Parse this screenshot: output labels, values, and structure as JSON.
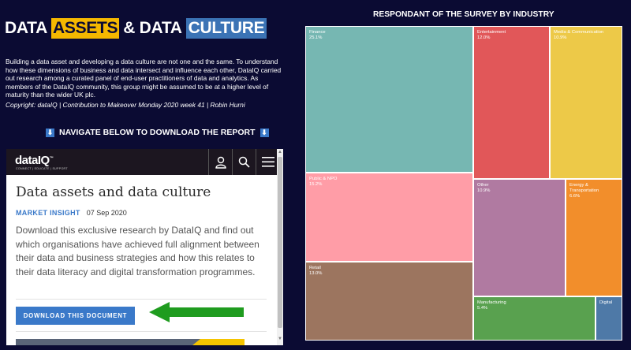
{
  "header": {
    "title_part1": "DATA",
    "title_part2": "ASSETS",
    "title_part3": "& DATA",
    "title_part4": "CULTURE"
  },
  "intro": {
    "text": "Building a data asset and developing a data culture are not one and the same. To understand how these dimensions of business and data intersect and influence each other, DataIQ carried out research among a curated panel of end-user practitioners of data and analytics. As members of the DataIQ community, this group might be assumed to be at a higher level of maturity than the wider UK plc.",
    "copyright": "Copyright: dataIQ | Contribution to Makeover Monday 2020 week 41 | Robin Hurni"
  },
  "nav_cta": {
    "label": "NAVIGATE BELOW TO DOWNLOAD THE REPORT",
    "icon": "arrow-down-icon"
  },
  "embed": {
    "logo": "dataIQ",
    "logo_tm": "™",
    "logo_sub": "CONNECT | EDUCATE | SUPPORT",
    "icons": [
      "user-icon",
      "search-icon",
      "menu-icon"
    ],
    "article_title": "Data assets and data culture",
    "category": "MARKET INSIGHT",
    "date": "07 Sep 2020",
    "body": "Download this exclusive research by DataIQ and find out which organisations have achieved full alignment between their data and business strategies and how this relates to their data literacy and digital transformation programmes.",
    "download_label": "DOWNLOAD THIS DOCUMENT"
  },
  "chart_data": {
    "type": "treemap",
    "title": "RESPONDANT OF THE SURVEY BY INDUSTRY",
    "series": [
      {
        "name": "Finance",
        "value": 25.1,
        "label": "25.1%",
        "color": "#76b7b2"
      },
      {
        "name": "Entertainment",
        "value": 12.0,
        "label": "12.0%",
        "color": "#e15759"
      },
      {
        "name": "Media & Communication",
        "value": 10.9,
        "label": "10.9%",
        "color": "#edc948"
      },
      {
        "name": "Public & NPO",
        "value": 15.2,
        "label": "15.2%",
        "color": "#ff9da7"
      },
      {
        "name": "Other",
        "value": 10.9,
        "label": "10.9%",
        "color": "#b07aa1"
      },
      {
        "name": "Energy & Transportation",
        "value": 6.6,
        "label": "6.6%",
        "color": "#f28e2b"
      },
      {
        "name": "Retail",
        "value": 13.0,
        "label": "13.0%",
        "color": "#9c755f"
      },
      {
        "name": "Manufacturing",
        "value": 5.4,
        "label": "5.4%",
        "color": "#59a14f"
      },
      {
        "name": "Digital",
        "value": 0,
        "label": "",
        "color": "#4e79a7"
      }
    ]
  }
}
